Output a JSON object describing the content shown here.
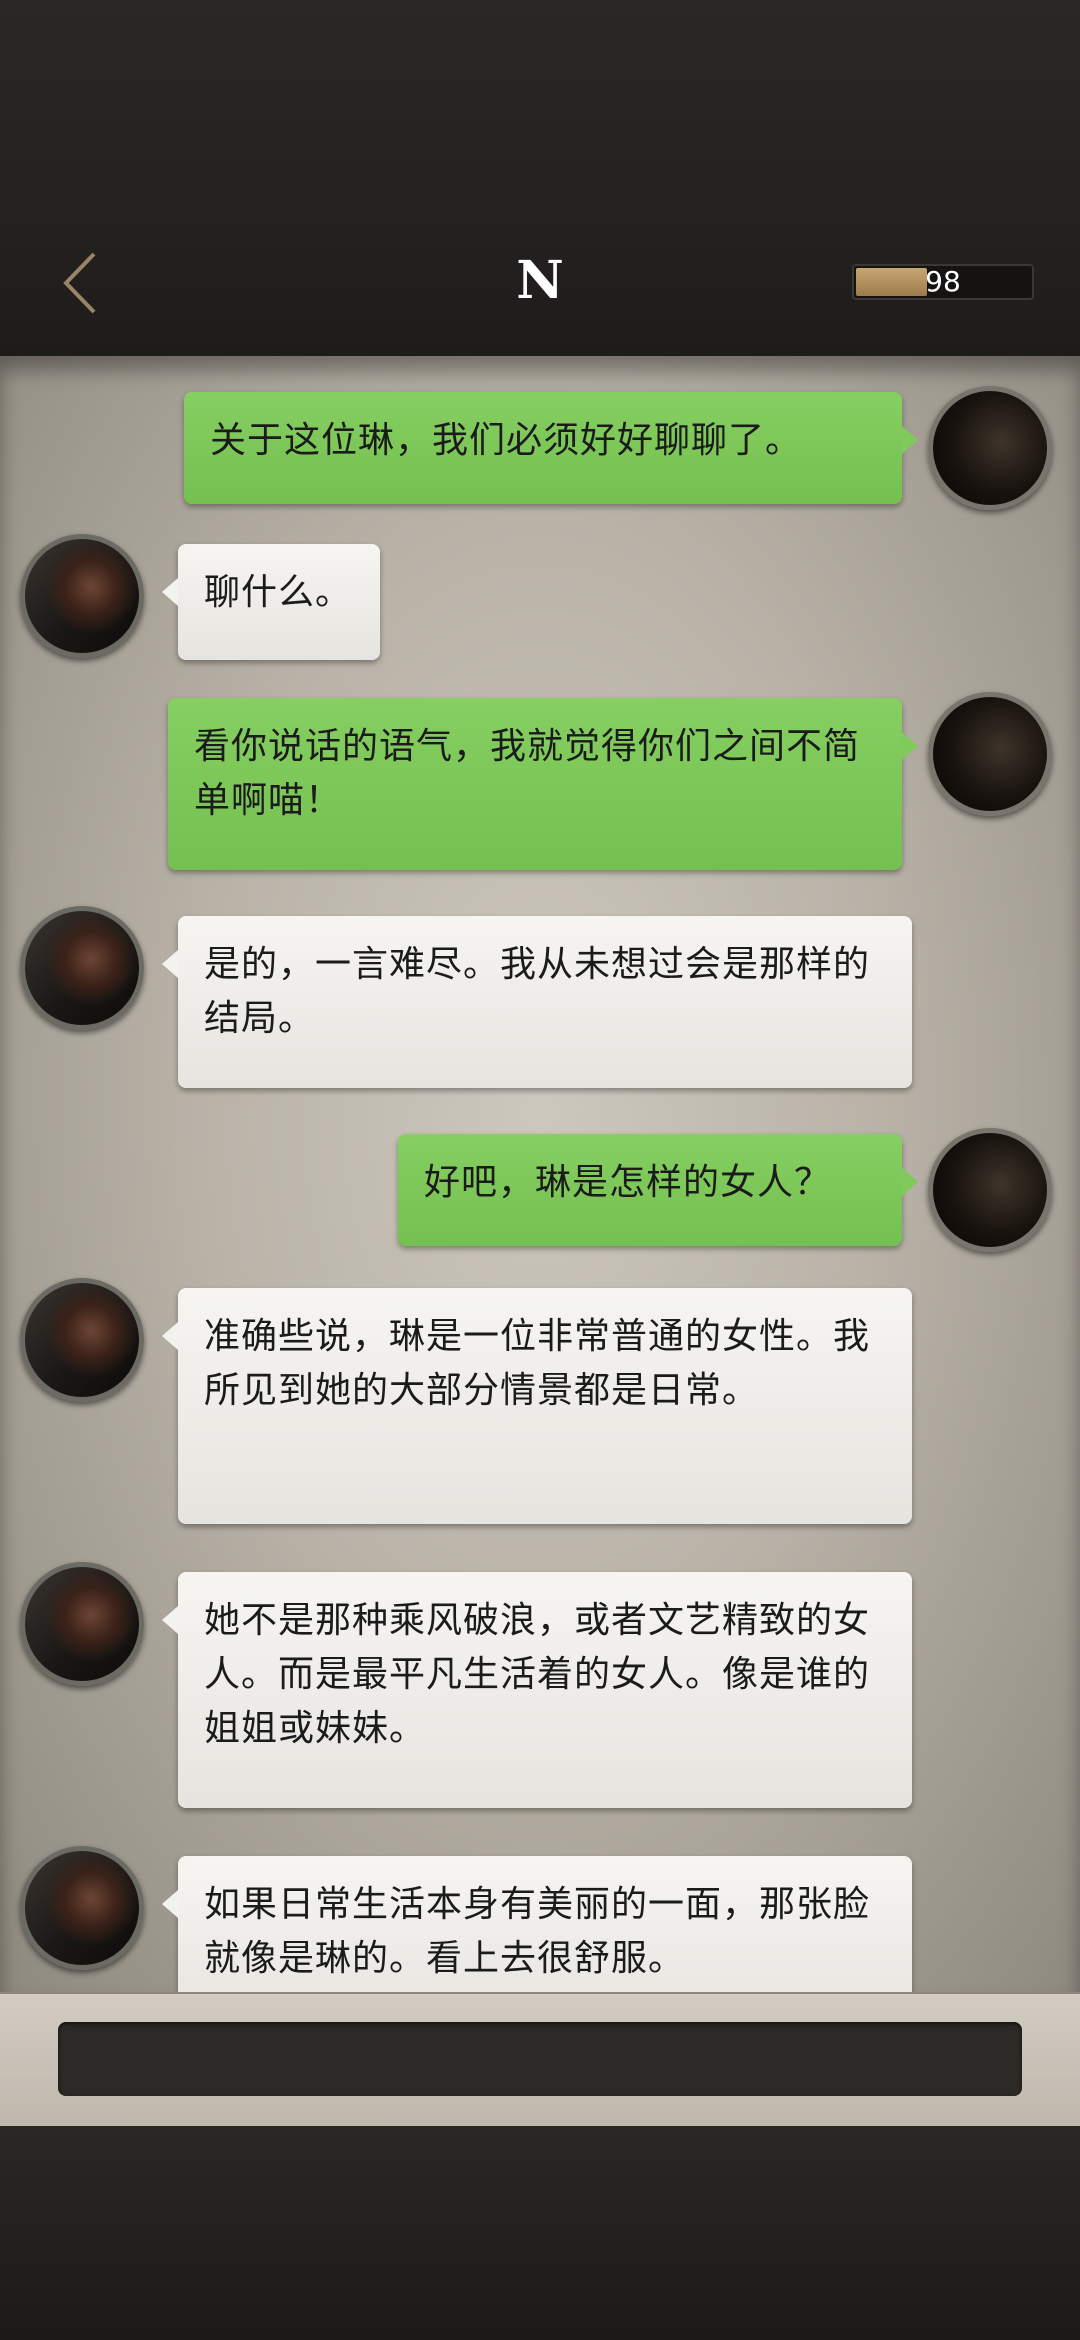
{
  "header": {
    "title": "N",
    "meter_value": "98",
    "meter_fraction": 0.98
  },
  "messages": [
    {
      "side": "me",
      "text": "关于这位琳，我们必须好好聊聊了。"
    },
    {
      "side": "npc",
      "text": "聊什么。"
    },
    {
      "side": "me",
      "text": "看你说话的语气，我就觉得你们之间不简单啊喵！"
    },
    {
      "side": "npc",
      "text": "是的，一言难尽。我从未想过会是那样的结局。"
    },
    {
      "side": "me",
      "text": "好吧，琳是怎样的女人？"
    },
    {
      "side": "npc",
      "text": "准确些说，琳是一位非常普通的女性。我所见到她的大部分情景都是日常。"
    },
    {
      "side": "npc",
      "text": "她不是那种乘风破浪，或者文艺精致的女人。而是最平凡生活着的女人。像是谁的姐姐或妹妹。"
    },
    {
      "side": "npc",
      "text": "如果日常生活本身有美丽的一面，那张脸就像是琳的。看上去很舒服。"
    }
  ],
  "input": {
    "value": ""
  }
}
